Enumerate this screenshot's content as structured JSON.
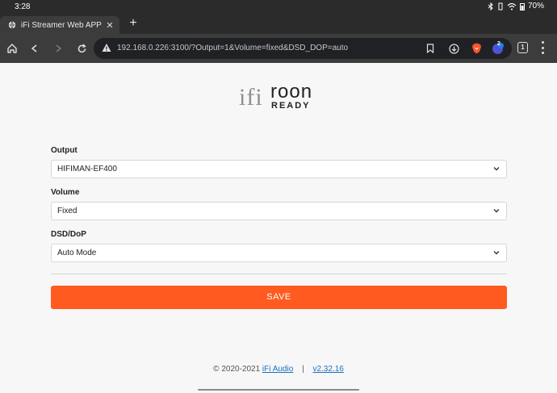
{
  "status": {
    "time": "3:28",
    "battery": "70%"
  },
  "browser": {
    "tab_title": "iFi Streamer Web APP",
    "new_tab": "+",
    "url": "192.168.0.226:3100/?Output=1&Volume=fixed&DSD_DOP=auto",
    "tab_count": "1",
    "extension_badge": "2"
  },
  "logo": {
    "brand": "ifi",
    "partner": "roon",
    "partner_sub": "READY"
  },
  "form": {
    "output": {
      "label": "Output",
      "value": "HIFIMAN-EF400"
    },
    "volume": {
      "label": "Volume",
      "value": "Fixed"
    },
    "dsd": {
      "label": "DSD/DoP",
      "value": "Auto Mode"
    },
    "save_label": "SAVE"
  },
  "footer": {
    "copyright": "© 2020-2021",
    "brand_link": "iFi Audio",
    "separator": "|",
    "version_link": "v2.32.16"
  },
  "colors": {
    "accent": "#ff5a1f",
    "link": "#1a6fc0",
    "toolbar": "#3c3c3c"
  },
  "icons": [
    "globe-icon",
    "close-icon",
    "home-icon",
    "back-icon",
    "forward-icon",
    "reload-icon",
    "warning-icon",
    "bookmark-icon",
    "download-icon",
    "brave-icon",
    "extension-icon",
    "menu-icon",
    "chevron-down-icon"
  ]
}
